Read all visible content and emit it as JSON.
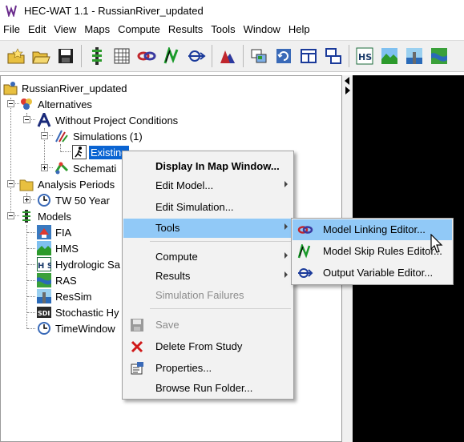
{
  "window": {
    "title": "HEC-WAT 1.1 - RussianRiver_updated"
  },
  "menubar": [
    "File",
    "Edit",
    "View",
    "Maps",
    "Compute",
    "Results",
    "Tools",
    "Window",
    "Help"
  ],
  "tree": {
    "root": "RussianRiver_updated",
    "alternatives": "Alternatives",
    "without_project": "Without Project Conditions",
    "simulations": "Simulations (1)",
    "existing": "Existing",
    "schematic": "Schemati",
    "analysis_periods": "Analysis Periods",
    "tw50": "TW 50 Year",
    "models": "Models",
    "model_items": [
      "FIA",
      "HMS",
      "Hydrologic Sa",
      "RAS",
      "ResSim",
      "Stochastic Hy",
      "TimeWindow"
    ],
    "sdi_badge": "SDI",
    "hs_badge": "H S"
  },
  "context_menu": {
    "display_map": "Display In Map Window...",
    "edit_model": "Edit Model...",
    "edit_simulation": "Edit Simulation...",
    "tools": "Tools",
    "compute": "Compute",
    "results": "Results",
    "simulation_failures": "Simulation Failures",
    "save": "Save",
    "delete": "Delete From Study",
    "properties": "Properties...",
    "browse": "Browse Run Folder..."
  },
  "tools_submenu": {
    "model_linking": "Model Linking Editor...",
    "model_skip": "Model Skip Rules Editor...",
    "output_variable": "Output Variable Editor..."
  },
  "colors": {
    "selection": "#0a64d2",
    "menu_highlight": "#91c9f7",
    "menu_bg": "#f2f2f2",
    "map_bg": "#000000"
  }
}
